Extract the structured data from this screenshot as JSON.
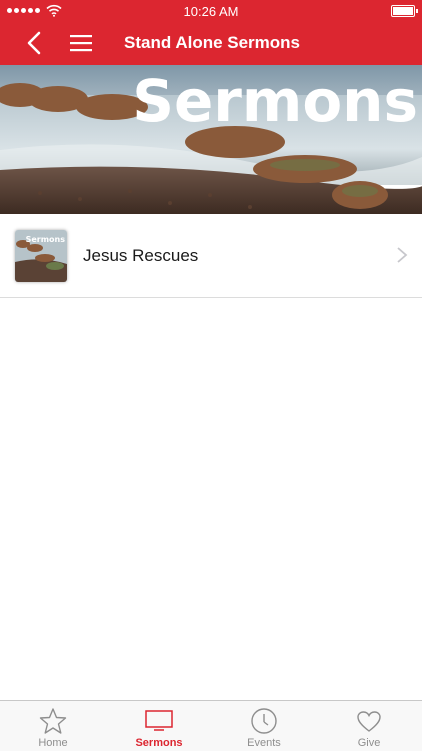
{
  "status_bar": {
    "time": "10:26 AM"
  },
  "nav": {
    "title": "Stand Alone Sermons"
  },
  "banner": {
    "overlay_text": "Sermons"
  },
  "items": [
    {
      "title": "Jesus Rescues",
      "thumb_text": "Sermons"
    }
  ],
  "tabs": [
    {
      "label": "Home",
      "icon": "star-icon",
      "active": false
    },
    {
      "label": "Sermons",
      "icon": "tv-icon",
      "active": true
    },
    {
      "label": "Events",
      "icon": "clock-icon",
      "active": false
    },
    {
      "label": "Give",
      "icon": "heart-icon",
      "active": false
    }
  ],
  "colors": {
    "brand": "#dc2630",
    "inactive": "#8e8e8e",
    "divider": "#dcdcdc"
  }
}
